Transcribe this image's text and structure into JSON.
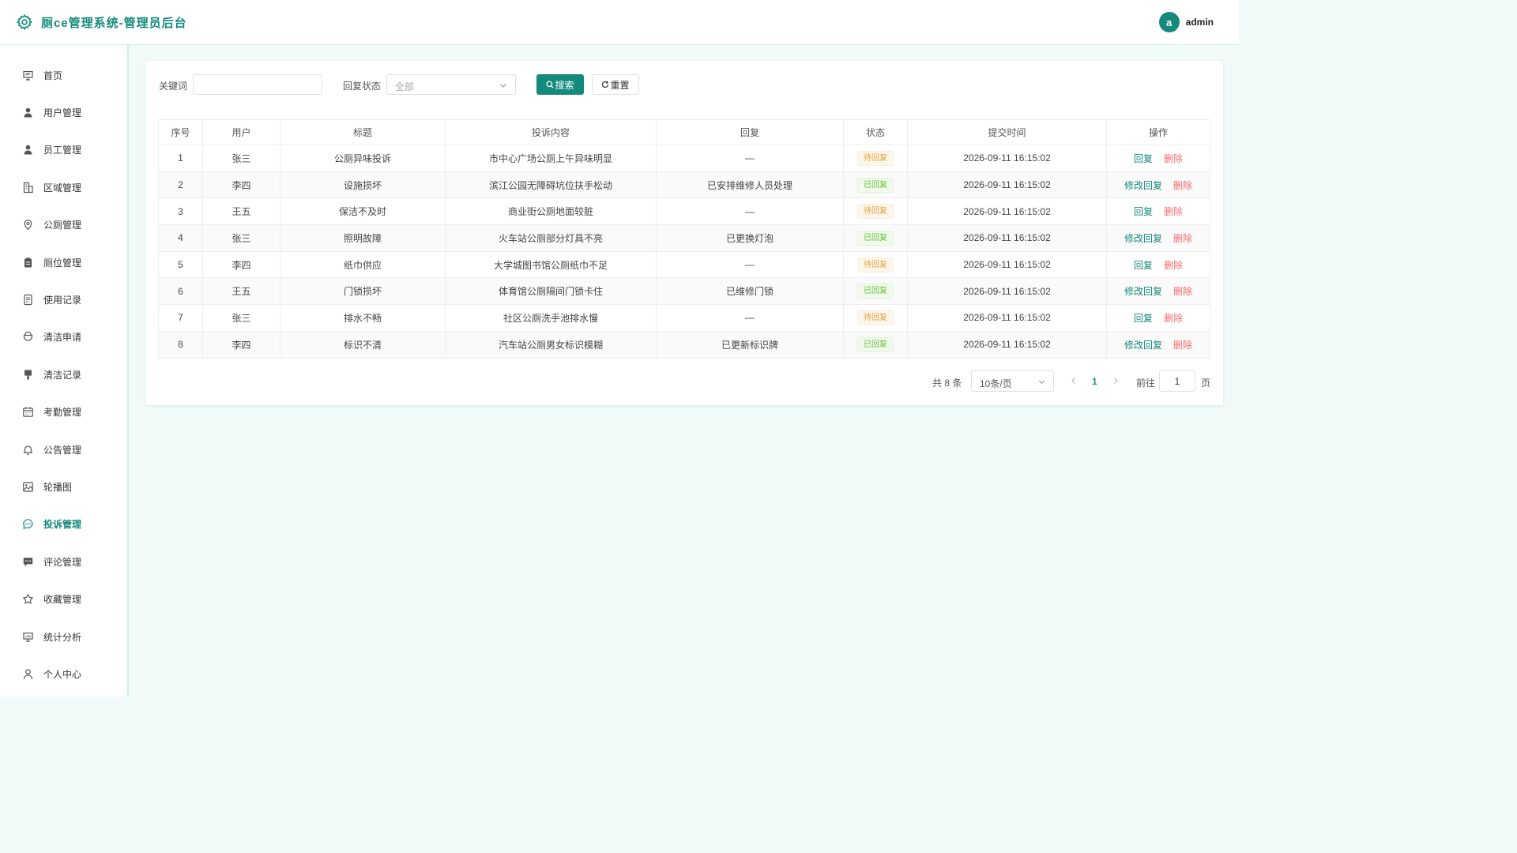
{
  "header": {
    "title": "厕ce管理系统-管理员后台",
    "avatar_letter": "a",
    "username": "admin"
  },
  "sidebar": {
    "items": [
      {
        "label": "首页",
        "icon": "presentation-icon"
      },
      {
        "label": "用户管理",
        "icon": "user-icon"
      },
      {
        "label": "员工管理",
        "icon": "user-icon"
      },
      {
        "label": "区域管理",
        "icon": "building-icon"
      },
      {
        "label": "公厕管理",
        "icon": "location-icon"
      },
      {
        "label": "厕位管理",
        "icon": "clipboard-icon"
      },
      {
        "label": "使用记录",
        "icon": "document-icon"
      },
      {
        "label": "清洁申请",
        "icon": "cup-icon"
      },
      {
        "label": "清洁记录",
        "icon": "brush-icon"
      },
      {
        "label": "考勤管理",
        "icon": "calendar-icon"
      },
      {
        "label": "公告管理",
        "icon": "bell-icon"
      },
      {
        "label": "轮播图",
        "icon": "picture-icon"
      },
      {
        "label": "投诉管理",
        "icon": "chat-icon",
        "active": true
      },
      {
        "label": "评论管理",
        "icon": "comment-icon"
      },
      {
        "label": "收藏管理",
        "icon": "star-icon"
      },
      {
        "label": "统计分析",
        "icon": "data-board-icon"
      },
      {
        "label": "个人中心",
        "icon": "person-icon"
      }
    ]
  },
  "filters": {
    "keyword_label": "关键词",
    "keyword_value": "",
    "status_label": "回复状态",
    "status_value": "全部",
    "search_label": "搜索",
    "reset_label": "重置"
  },
  "table": {
    "columns": [
      "序号",
      "用户",
      "标题",
      "投诉内容",
      "回复",
      "状态",
      "提交时间",
      "操作"
    ],
    "rows": [
      {
        "no": "1",
        "user": "张三",
        "title": "公厕异味投诉",
        "content": "市中心广场公厕上午异味明显",
        "reply": "—",
        "status": "待回复",
        "time": "2026-09-11 16:15:02",
        "action": "回复"
      },
      {
        "no": "2",
        "user": "李四",
        "title": "设施损坏",
        "content": "滨江公园无障碍坑位扶手松动",
        "reply": "已安排维修人员处理",
        "status": "已回复",
        "time": "2026-09-11 16:15:02",
        "action": "修改回复"
      },
      {
        "no": "3",
        "user": "王五",
        "title": "保洁不及时",
        "content": "商业街公厕地面较脏",
        "reply": "—",
        "status": "待回复",
        "time": "2026-09-11 16:15:02",
        "action": "回复"
      },
      {
        "no": "4",
        "user": "张三",
        "title": "照明故障",
        "content": "火车站公厕部分灯具不亮",
        "reply": "已更换灯泡",
        "status": "已回复",
        "time": "2026-09-11 16:15:02",
        "action": "修改回复"
      },
      {
        "no": "5",
        "user": "李四",
        "title": "纸巾供应",
        "content": "大学城图书馆公厕纸巾不足",
        "reply": "—",
        "status": "待回复",
        "time": "2026-09-11 16:15:02",
        "action": "回复"
      },
      {
        "no": "6",
        "user": "王五",
        "title": "门锁损坏",
        "content": "体育馆公厕隔间门锁卡住",
        "reply": "已维修门锁",
        "status": "已回复",
        "time": "2026-09-11 16:15:02",
        "action": "修改回复"
      },
      {
        "no": "7",
        "user": "张三",
        "title": "排水不畅",
        "content": "社区公厕洗手池排水慢",
        "reply": "—",
        "status": "待回复",
        "time": "2026-09-11 16:15:02",
        "action": "回复"
      },
      {
        "no": "8",
        "user": "李四",
        "title": "标识不清",
        "content": "汽车站公厕男女标识模糊",
        "reply": "已更新标识牌",
        "status": "已回复",
        "time": "2026-09-11 16:15:02",
        "action": "修改回复"
      }
    ],
    "delete_label": "删除"
  },
  "pagination": {
    "total": "共 8 条",
    "page_size": "10条/页",
    "current_page": "1",
    "goto_label": "前往",
    "goto_value": "1",
    "page_suffix": "页"
  },
  "colors": {
    "accent": "#138a7c",
    "danger": "#f56c6c",
    "pending": "#e6a23c",
    "done": "#67c23a"
  }
}
